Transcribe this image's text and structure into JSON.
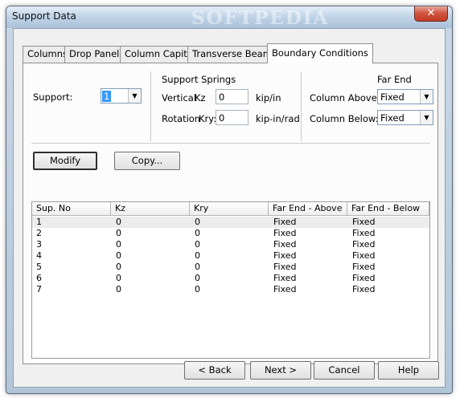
{
  "window": {
    "title": "Support Data",
    "watermark": "SOFTPEDIA",
    "close_label": "✕"
  },
  "tabs": [
    {
      "label": "Columns"
    },
    {
      "label": "Drop Panels"
    },
    {
      "label": "Column Capitals"
    },
    {
      "label": "Transverse Beams"
    },
    {
      "label": "Boundary Conditions",
      "active": true
    }
  ],
  "support": {
    "label": "Support:",
    "value": "1"
  },
  "springs": {
    "section_label": "Support Springs",
    "vertical_label": "Vertical",
    "kz_label": "Kz",
    "kz_value": "0",
    "kz_unit": "kip/in",
    "rotation_label": "Rotation",
    "kry_label": "Kry:",
    "kry_value": "0",
    "kry_unit": "kip-in/rad"
  },
  "far_end": {
    "section_label": "Far End",
    "above_label": "Column Above:",
    "above_value": "Fixed",
    "below_label": "Column Below:",
    "below_value": "Fixed"
  },
  "actions": {
    "modify_label": "Modify",
    "copy_label": "Copy..."
  },
  "table": {
    "columns": [
      "Sup. No",
      "Kz",
      "Kry",
      "Far End - Above",
      "Far End - Below"
    ],
    "rows": [
      [
        "1",
        "0",
        "0",
        "Fixed",
        "Fixed"
      ],
      [
        "2",
        "0",
        "0",
        "Fixed",
        "Fixed"
      ],
      [
        "3",
        "0",
        "0",
        "Fixed",
        "Fixed"
      ],
      [
        "4",
        "0",
        "0",
        "Fixed",
        "Fixed"
      ],
      [
        "5",
        "0",
        "0",
        "Fixed",
        "Fixed"
      ],
      [
        "6",
        "0",
        "0",
        "Fixed",
        "Fixed"
      ],
      [
        "7",
        "0",
        "0",
        "Fixed",
        "Fixed"
      ]
    ]
  },
  "footer": {
    "back_label": "< Back",
    "next_label": "Next >",
    "cancel_label": "Cancel",
    "help_label": "Help"
  }
}
